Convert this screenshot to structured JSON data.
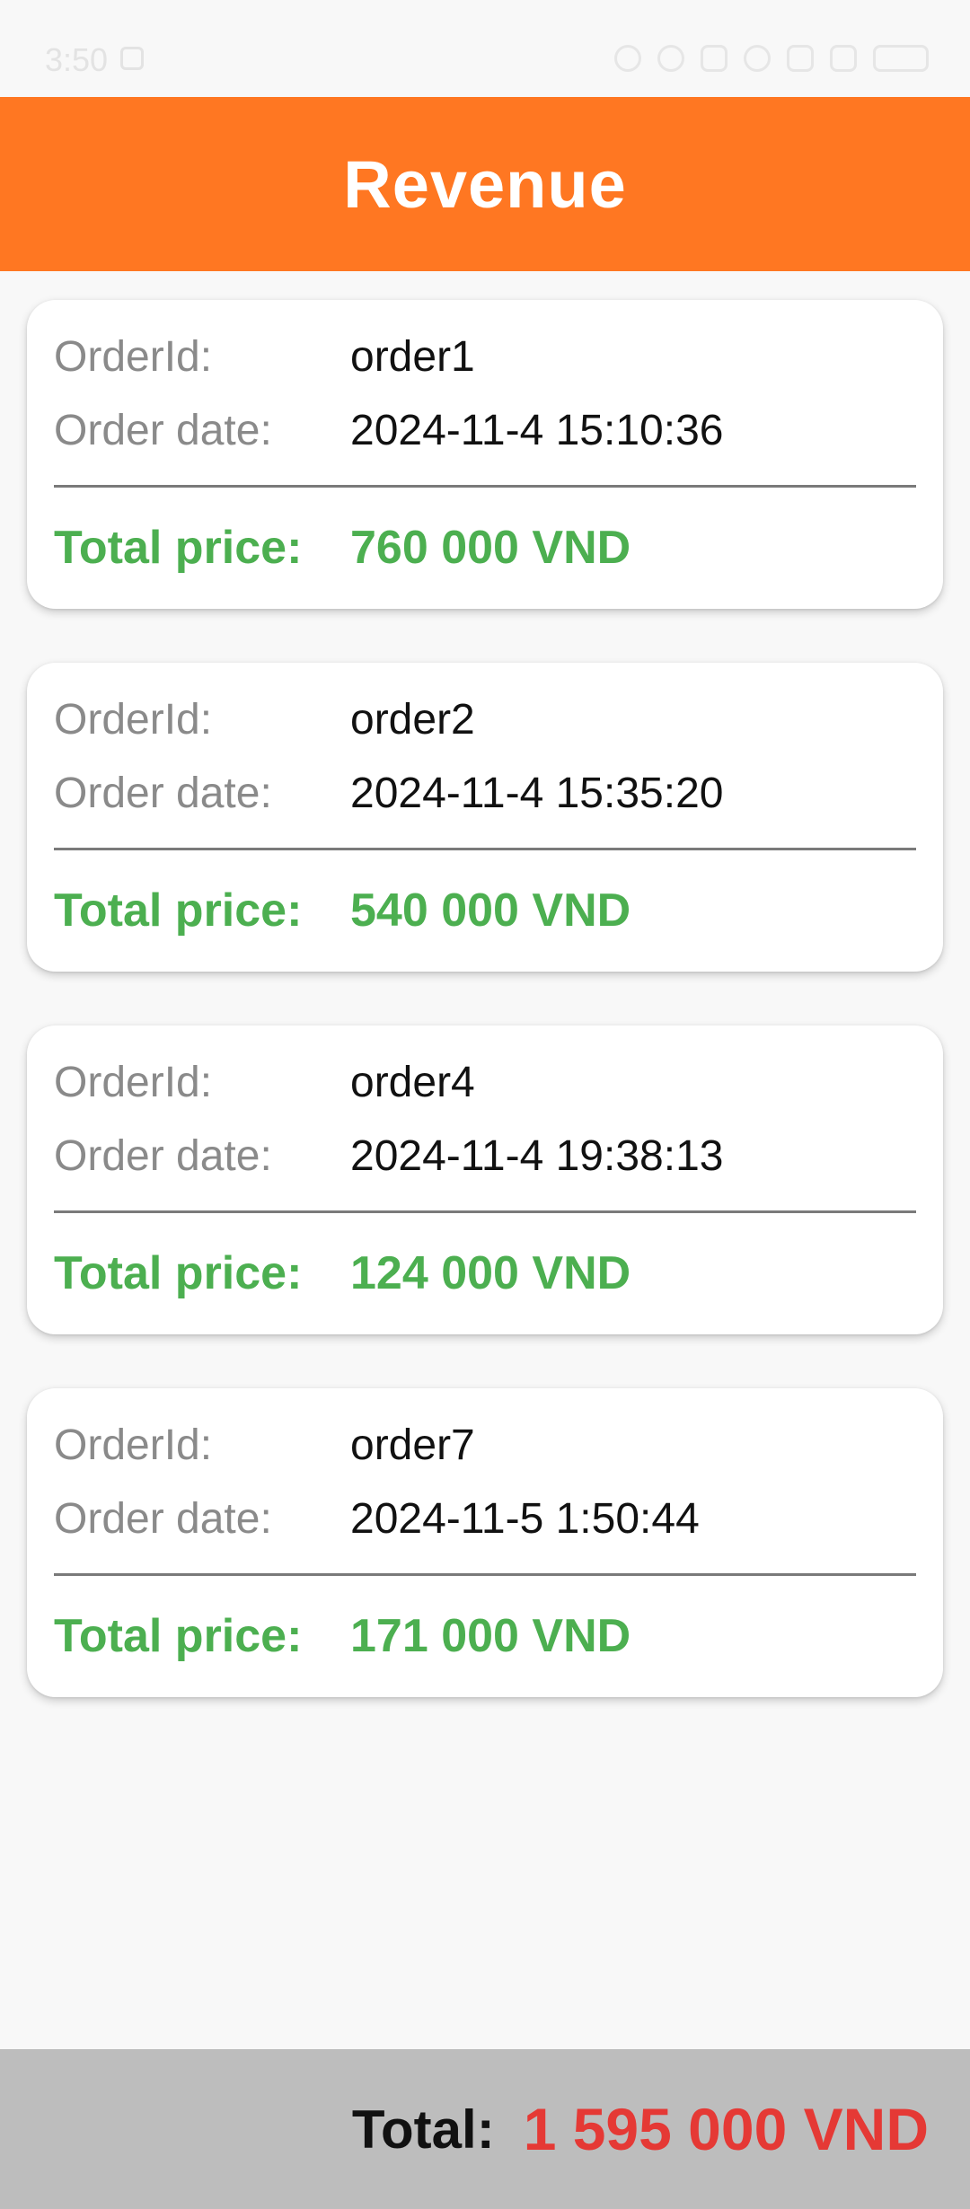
{
  "status_bar": {
    "time": "3:50",
    "icons": [
      "alarm-icon",
      "mute-icon",
      "data-icon",
      "wifi-icon",
      "signal-icon",
      "signal-icon",
      "battery-icon"
    ],
    "battery": "100"
  },
  "app_bar": {
    "title": "Revenue"
  },
  "orders": [
    {
      "id_label": "OrderId:",
      "id": "order1",
      "date_label": "Order date:",
      "date": "2024-11-4 15:10:36",
      "total_label": "Total price:",
      "total": "760 000 VND"
    },
    {
      "id_label": "OrderId:",
      "id": "order2",
      "date_label": "Order date:",
      "date": "2024-11-4 15:35:20",
      "total_label": "Total price:",
      "total": "540 000 VND"
    },
    {
      "id_label": "OrderId:",
      "id": "order4",
      "date_label": "Order date:",
      "date": "2024-11-4 19:38:13",
      "total_label": "Total price:",
      "total": "124 000 VND"
    },
    {
      "id_label": "OrderId:",
      "id": "order7",
      "date_label": "Order date:",
      "date": "2024-11-5 1:50:44",
      "total_label": "Total price:",
      "total": "171 000 VND"
    }
  ],
  "footer": {
    "label": "Total:",
    "value": "1 595 000 VND"
  },
  "colors": {
    "app_bar": "#ff7722",
    "total_price": "#4caf50",
    "grand_total": "#e53935",
    "footer_bg": "#bdbdbd"
  }
}
